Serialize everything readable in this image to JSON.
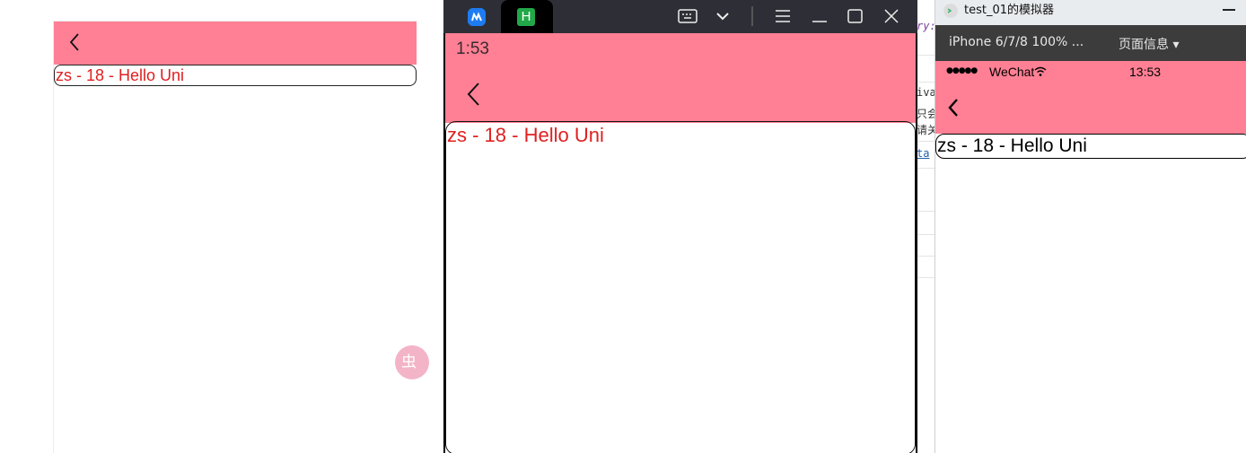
{
  "browser_preview": {
    "content_text": "zs - 18 - Hello Uni",
    "nav_color": "#ff8094",
    "float_button_text": "虫"
  },
  "emulator": {
    "status_time": "1:53",
    "content_text": "zs - 18 - Hello Uni",
    "titlebar_icons": [
      "dcloud-app-icon",
      "hbuilder-h-icon",
      "keyboard-icon",
      "chevron-down-icon",
      "menu-icon",
      "minimize-icon",
      "maximize-icon",
      "close-icon"
    ],
    "app_icon_label": "H"
  },
  "code_editor": {
    "fragments": [
      "ry:",
      "iva",
      "只会",
      "请关",
      "ta"
    ]
  },
  "wechat_simulator": {
    "window_title": "test_01的模拟器",
    "device_label": "iPhone 6/7/8 100% ...",
    "page_info_label": "页面信息 ▾",
    "signal": "●●●●●",
    "carrier": "WeChat",
    "time": "13:53",
    "content_text": "zs - 18 - Hello Uni"
  },
  "colors": {
    "accent_pink": "#ff8094",
    "content_red": "#e02020",
    "titlebar_dark": "#2e2f36",
    "toolbar_dark": "#3c3c3c"
  }
}
